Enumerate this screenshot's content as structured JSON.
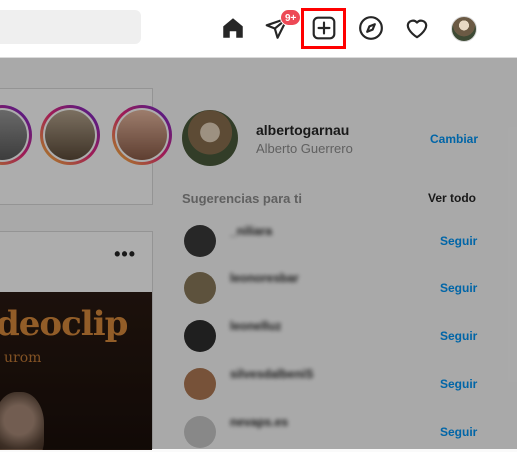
{
  "header": {
    "search": {
      "placeholder": "",
      "value": ""
    },
    "notification_badge": "9+",
    "icons": [
      "home-icon",
      "direct-message-icon",
      "new-post-icon",
      "explore-icon",
      "activity-icon",
      "profile-avatar"
    ],
    "highlight_color": "#ff0000"
  },
  "stories": [
    {
      "name": ""
    },
    {
      "name": ""
    },
    {
      "name": ""
    }
  ],
  "post": {
    "image_title": "deoclip",
    "image_subtitle": "urom",
    "more": "•••"
  },
  "profile": {
    "username": "albertogarnau",
    "full_name": "Alberto Guerrero",
    "switch_label": "Cambiar"
  },
  "suggestions": {
    "title": "Sugerencias para ti",
    "see_all": "Ver todo",
    "items": [
      {
        "username": "_niliara",
        "subtitle": "",
        "action": "Seguir",
        "avatar_color": "#3a3a3a"
      },
      {
        "username": "leonoresbar",
        "subtitle": "",
        "action": "Seguir",
        "avatar_color": "#8a7a5a"
      },
      {
        "username": "leonelluz",
        "subtitle": "",
        "action": "Seguir",
        "avatar_color": "#2e2e2e"
      },
      {
        "username": "silvesdalbeniS",
        "subtitle": "",
        "action": "Seguir",
        "avatar_color": "#b07a55"
      },
      {
        "username": "nevaps.es",
        "subtitle": "",
        "action": "Seguir",
        "avatar_color": "#c9c9c9"
      }
    ]
  },
  "colors": {
    "link": "#0095f6",
    "badge": "#ed4956"
  }
}
